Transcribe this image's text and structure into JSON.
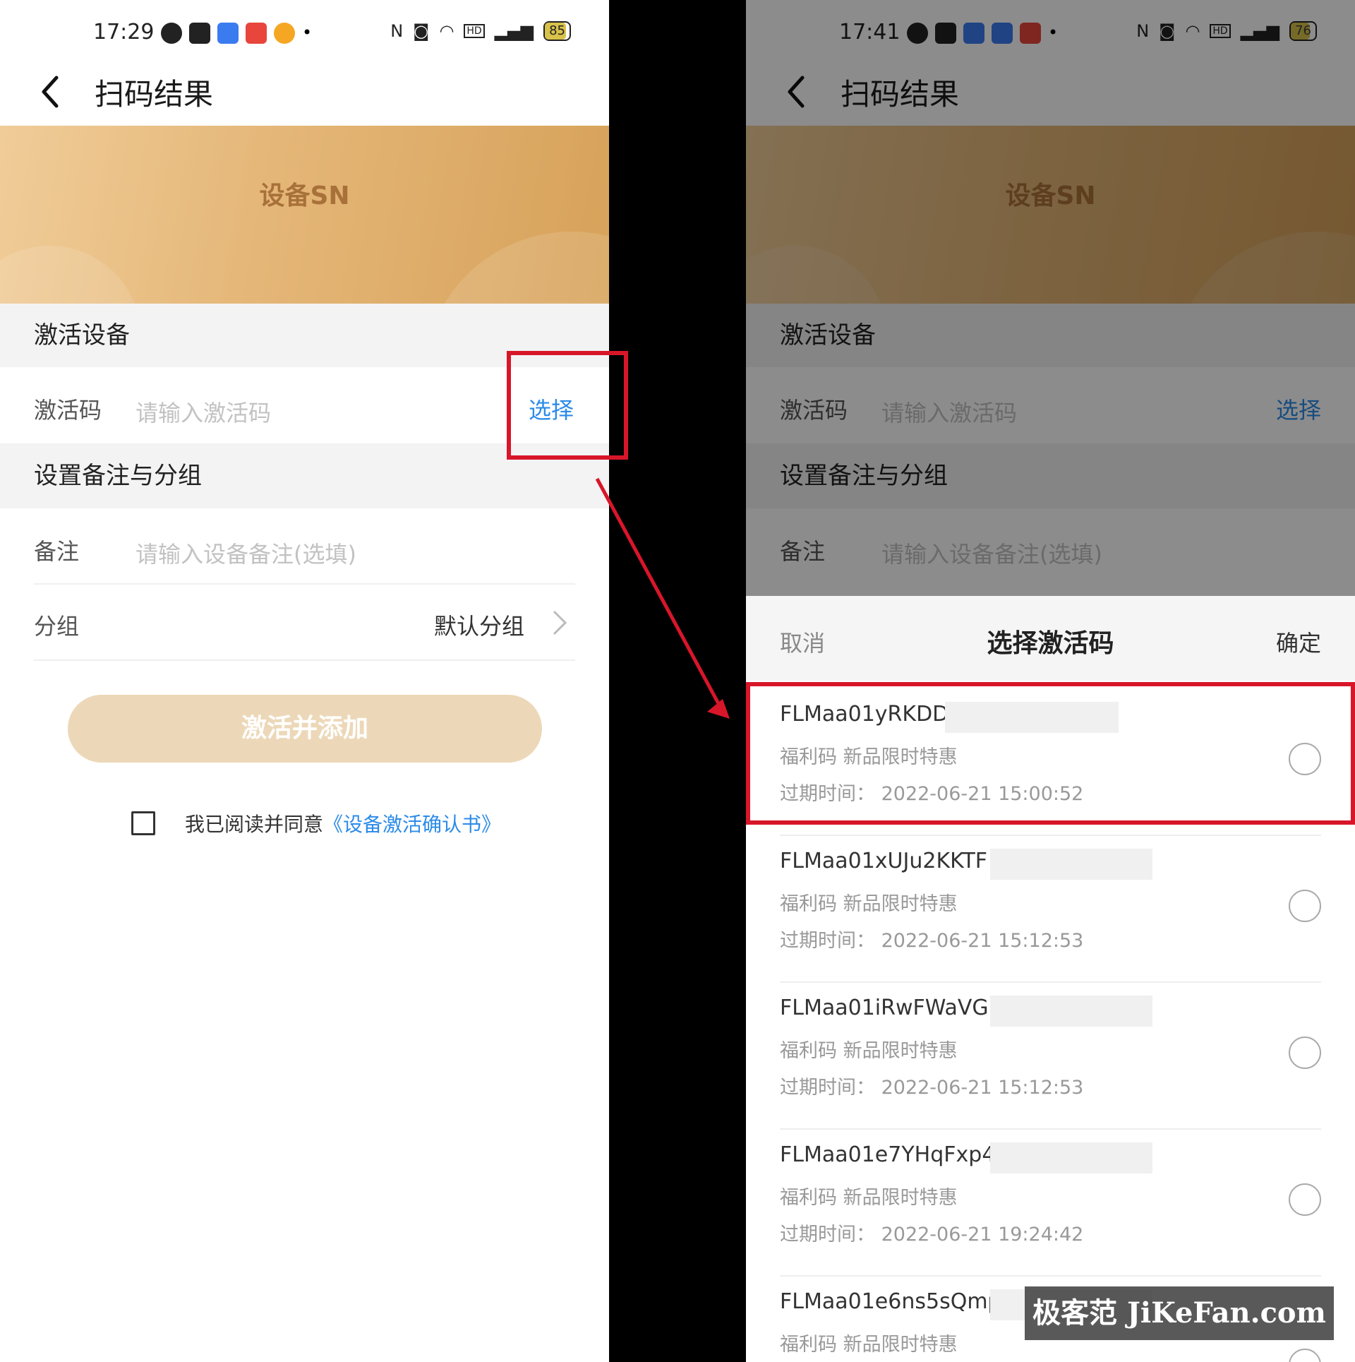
{
  "left": {
    "status": {
      "time": "17:29",
      "battery": "85"
    },
    "header": {
      "title": "扫码结果"
    },
    "banner": {
      "title": "设备SN"
    },
    "sections": {
      "activate": "激活设备",
      "remark_group": "设置备注与分组"
    },
    "activation_row": {
      "label": "激活码",
      "placeholder": "请输入激活码",
      "select": "选择"
    },
    "remark_row": {
      "label": "备注",
      "placeholder": "请输入设备备注(选填)"
    },
    "group_row": {
      "label": "分组",
      "value": "默认分组"
    },
    "activate_button": "激活并添加",
    "agreement": {
      "text": "我已阅读并同意",
      "link": "《设备激活确认书》"
    }
  },
  "right": {
    "status": {
      "time": "17:41",
      "battery": "76"
    },
    "header": {
      "title": "扫码结果"
    },
    "banner": {
      "title": "设备SN"
    },
    "sections": {
      "activate": "激活设备",
      "remark_group": "设置备注与分组"
    },
    "activation_row": {
      "label": "激活码",
      "placeholder": "请输入激活码",
      "select": "选择"
    },
    "remark_row": {
      "label": "备注",
      "placeholder": "请输入设备备注(选填)"
    },
    "sheet": {
      "cancel": "取消",
      "title": "选择激活码",
      "confirm": "确定"
    },
    "codes": [
      {
        "code": "FLMaa01yRKDDvjb",
        "tag": "福利码 新品限时特惠",
        "expire": "过期时间：  2022-06-21 15:00:52"
      },
      {
        "code": "FLMaa01xUJu2KKTF",
        "tag": "福利码 新品限时特惠",
        "expire": "过期时间：  2022-06-21 15:12:53"
      },
      {
        "code": "FLMaa01iRwFWaVGU",
        "tag": "福利码 新品限时特惠",
        "expire": "过期时间：  2022-06-21 15:12:53"
      },
      {
        "code": "FLMaa01e7YHqFxp4",
        "tag": "福利码 新品限时特惠",
        "expire": "过期时间：  2022-06-21 19:24:42"
      },
      {
        "code": "FLMaa01e6ns5sQmp",
        "tag": "福利码 新品限时特惠",
        "expire": ""
      }
    ]
  },
  "watermark": "极客范 JiKeFan.com",
  "colors": {
    "accent_blue": "#2b8be8",
    "banner_gold": "#e4b677",
    "highlight_red": "#d8162a"
  }
}
